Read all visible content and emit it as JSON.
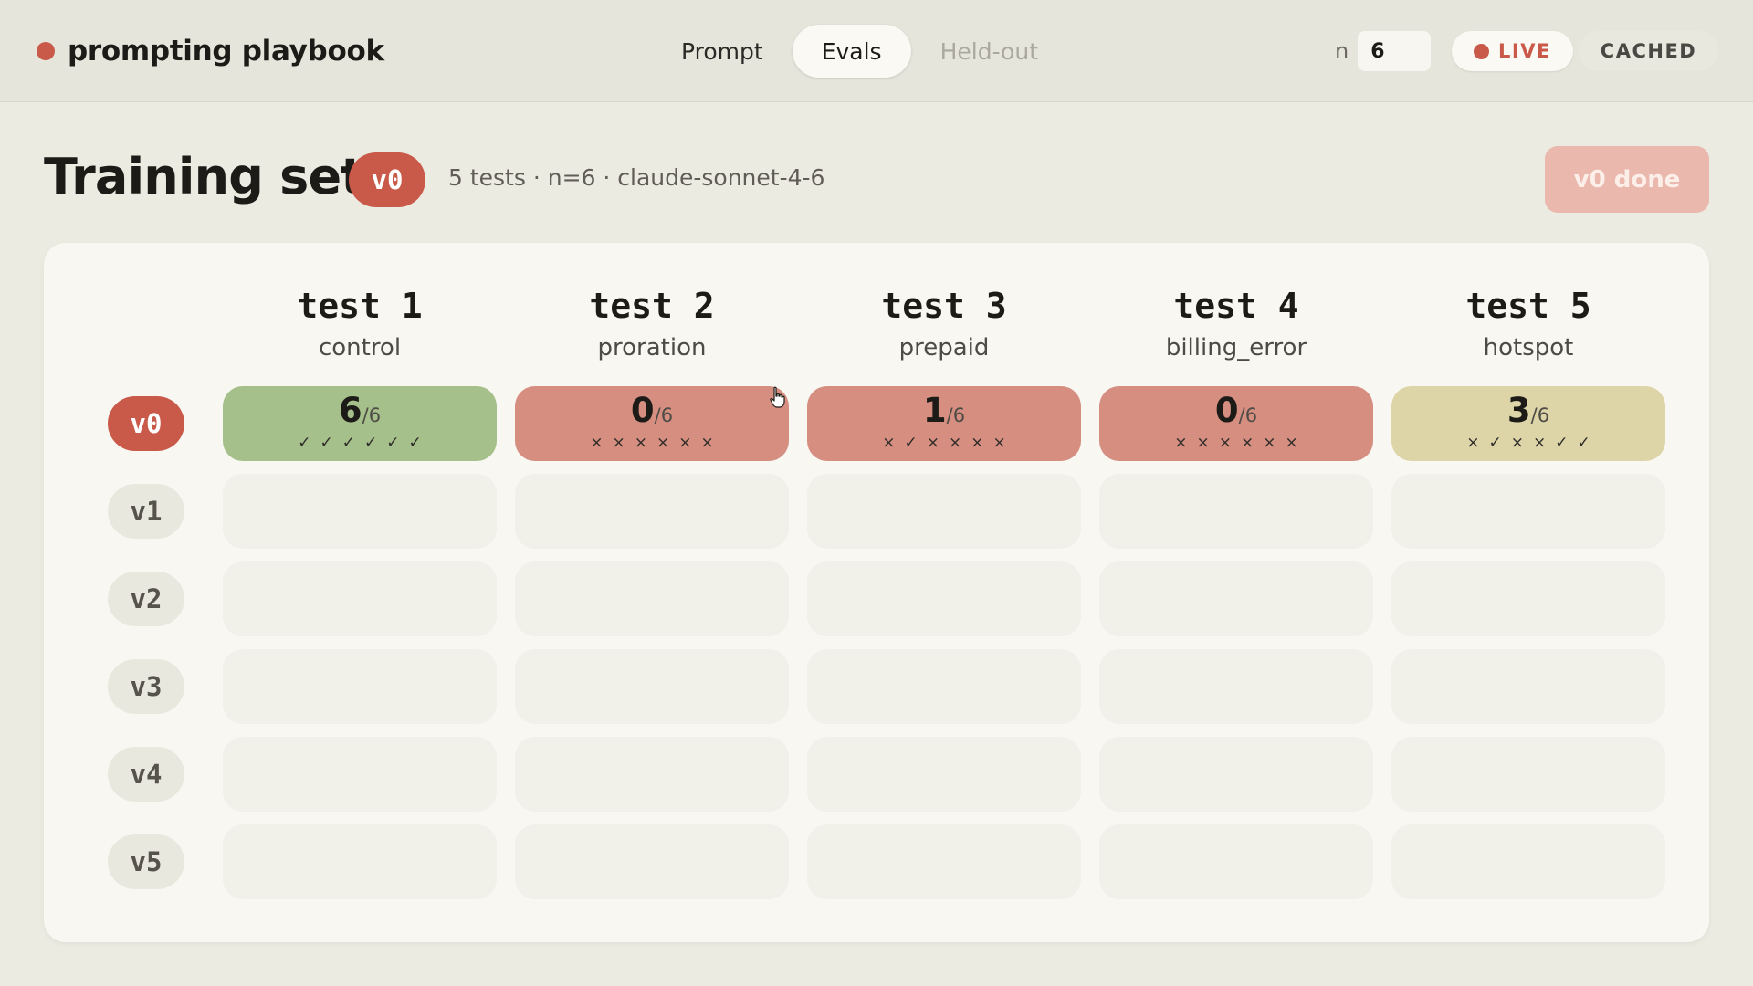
{
  "app": {
    "title": "prompting playbook",
    "accent": "#c95a49"
  },
  "tabs": [
    {
      "label": "Prompt",
      "state": "normal"
    },
    {
      "label": "Evals",
      "state": "active"
    },
    {
      "label": "Held-out",
      "state": "muted"
    }
  ],
  "n": {
    "label": "n",
    "value": "6"
  },
  "modes": {
    "live": "LIVE",
    "cached": "CACHED"
  },
  "header": {
    "title": "Training set",
    "version": "v0",
    "meta": "5 tests · n=6 · claude-sonnet-4-6",
    "done_label": "v0 done"
  },
  "tests": [
    {
      "name": "test 1",
      "sub": "control"
    },
    {
      "name": "test 2",
      "sub": "proration"
    },
    {
      "name": "test 3",
      "sub": "prepaid"
    },
    {
      "name": "test 4",
      "sub": "billing_error"
    },
    {
      "name": "test 5",
      "sub": "hotspot"
    }
  ],
  "versions": [
    "v0",
    "v1",
    "v2",
    "v3",
    "v4",
    "v5"
  ],
  "results": {
    "v0": [
      {
        "score": "6",
        "total": "/6",
        "status": "pass",
        "marks": "✓✓✓✓✓✓"
      },
      {
        "score": "0",
        "total": "/6",
        "status": "fail",
        "marks": "××××××"
      },
      {
        "score": "1",
        "total": "/6",
        "status": "fail",
        "marks": "×✓××××"
      },
      {
        "score": "0",
        "total": "/6",
        "status": "fail",
        "marks": "××××××"
      },
      {
        "score": "3",
        "total": "/6",
        "status": "mixed",
        "marks": "×✓××✓✓"
      }
    ]
  }
}
